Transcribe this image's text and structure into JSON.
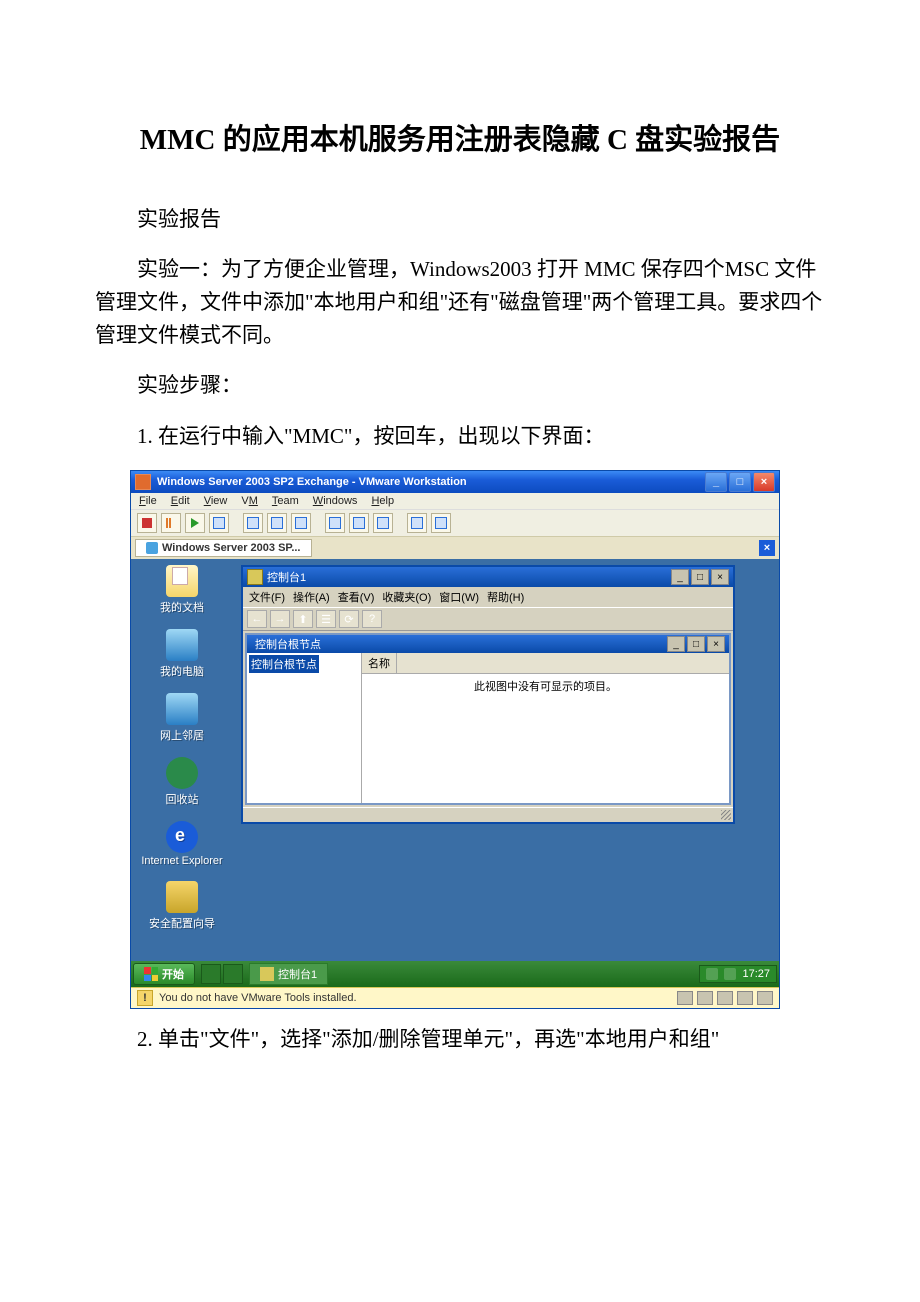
{
  "doc": {
    "title": "MMC 的应用本机服务用注册表隐藏 C 盘实验报告",
    "p1": "实验报告",
    "p2": "实验一：为了方便企业管理，Windows2003 打开 MMC 保存四个MSC 文件管理文件，文件中添加\"本地用户和组\"还有\"磁盘管理\"两个管理工具。要求四个管理文件模式不同。",
    "p3": "实验步骤：",
    "p4": "1. 在运行中输入\"MMC\"，按回车，出现以下界面：",
    "p5": "2. 单击\"文件\"，选择\"添加/删除管理单元\"，再选\"本地用户和组\""
  },
  "vm": {
    "title": "Windows Server 2003 SP2 Exchange - VMware Workstation",
    "menu": [
      "File",
      "Edit",
      "View",
      "VM",
      "Team",
      "Windows",
      "Help"
    ],
    "tab": "Windows Server 2003 SP...",
    "status": "You do not have VMware Tools installed."
  },
  "desktop": {
    "icons": [
      "我的文档",
      "我的电脑",
      "网上邻居",
      "回收站",
      "Internet Explorer",
      "安全配置向导"
    ]
  },
  "mmc": {
    "title": "控制台1",
    "menu": [
      "文件(F)",
      "操作(A)",
      "查看(V)",
      "收藏夹(O)",
      "窗口(W)",
      "帮助(H)"
    ],
    "inner_title": "控制台根节点",
    "tree_item": "控制台根节点",
    "col_name": "名称",
    "empty_msg": "此视图中没有可显示的项目。"
  },
  "taskbar": {
    "start": "开始",
    "task": "控制台1",
    "time": "17:27"
  }
}
